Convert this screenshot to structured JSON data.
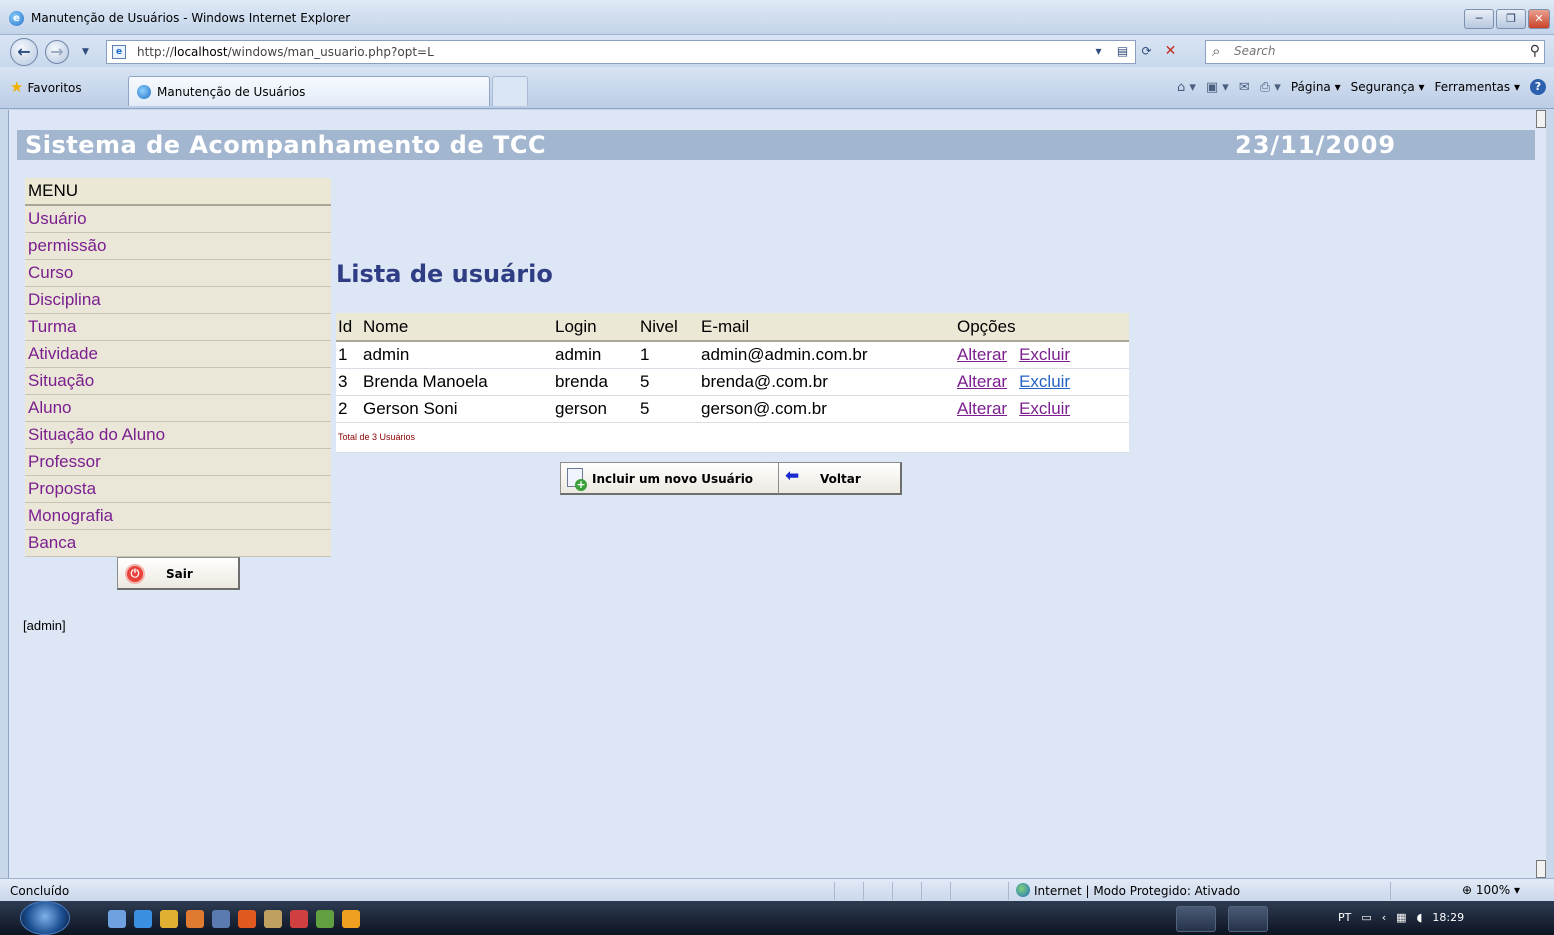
{
  "window": {
    "title": "Manutenção de Usuários - Windows Internet Explorer",
    "min_label": "─",
    "max_label": "❐",
    "close_label": "✕"
  },
  "address": {
    "url_prefix": "http://",
    "url_host": "localhost",
    "url_path": "/windows/man_usuario.php?opt=L"
  },
  "search": {
    "placeholder": "Search"
  },
  "tabs": {
    "favorites": "Favoritos",
    "active_tab": "Manutenção de Usuários"
  },
  "command_bar": {
    "page": "Página ▾",
    "security": "Segurança ▾",
    "tools": "Ferramentas ▾"
  },
  "header": {
    "title": "Sistema de Acompanhamento de TCC",
    "date": "23/11/2009"
  },
  "menu": {
    "heading": "MENU",
    "items": [
      {
        "label": "Usuário"
      },
      {
        "label": "permissão"
      },
      {
        "label": "Curso"
      },
      {
        "label": "Disciplina"
      },
      {
        "label": "Turma"
      },
      {
        "label": "Atividade"
      },
      {
        "label": "Situação"
      },
      {
        "label": "Aluno"
      },
      {
        "label": "Situação do Aluno"
      },
      {
        "label": "Professor"
      },
      {
        "label": "Proposta"
      },
      {
        "label": "Monografia"
      },
      {
        "label": "Banca"
      }
    ],
    "logout": "Sair"
  },
  "current_user": "[admin]",
  "main": {
    "title": "Lista de usuário",
    "columns": [
      "Id",
      "Nome",
      "Login",
      "Nivel",
      "E-mail",
      "Opções"
    ],
    "rows": [
      {
        "id": "1",
        "nome": "admin",
        "login": "admin",
        "nivel": "1",
        "email": "admin@admin.com.br"
      },
      {
        "id": "3",
        "nome": "Brenda Manoela",
        "login": "brenda",
        "nivel": "5",
        "email": "brenda@.com.br"
      },
      {
        "id": "2",
        "nome": "Gerson Soni",
        "login": "gerson",
        "nivel": "5",
        "email": "gerson@.com.br"
      }
    ],
    "edit_label": "Alterar",
    "delete_label": "Excluir",
    "total": "Total de 3 Usuários",
    "add_button": "Incluir um novo Usuário",
    "back_button": "Voltar"
  },
  "status": {
    "left": "Concluído",
    "zone": "Internet | Modo Protegido: Ativado",
    "zoom": "100%"
  },
  "taskbar": {
    "language": "PT",
    "time": "18:29"
  }
}
